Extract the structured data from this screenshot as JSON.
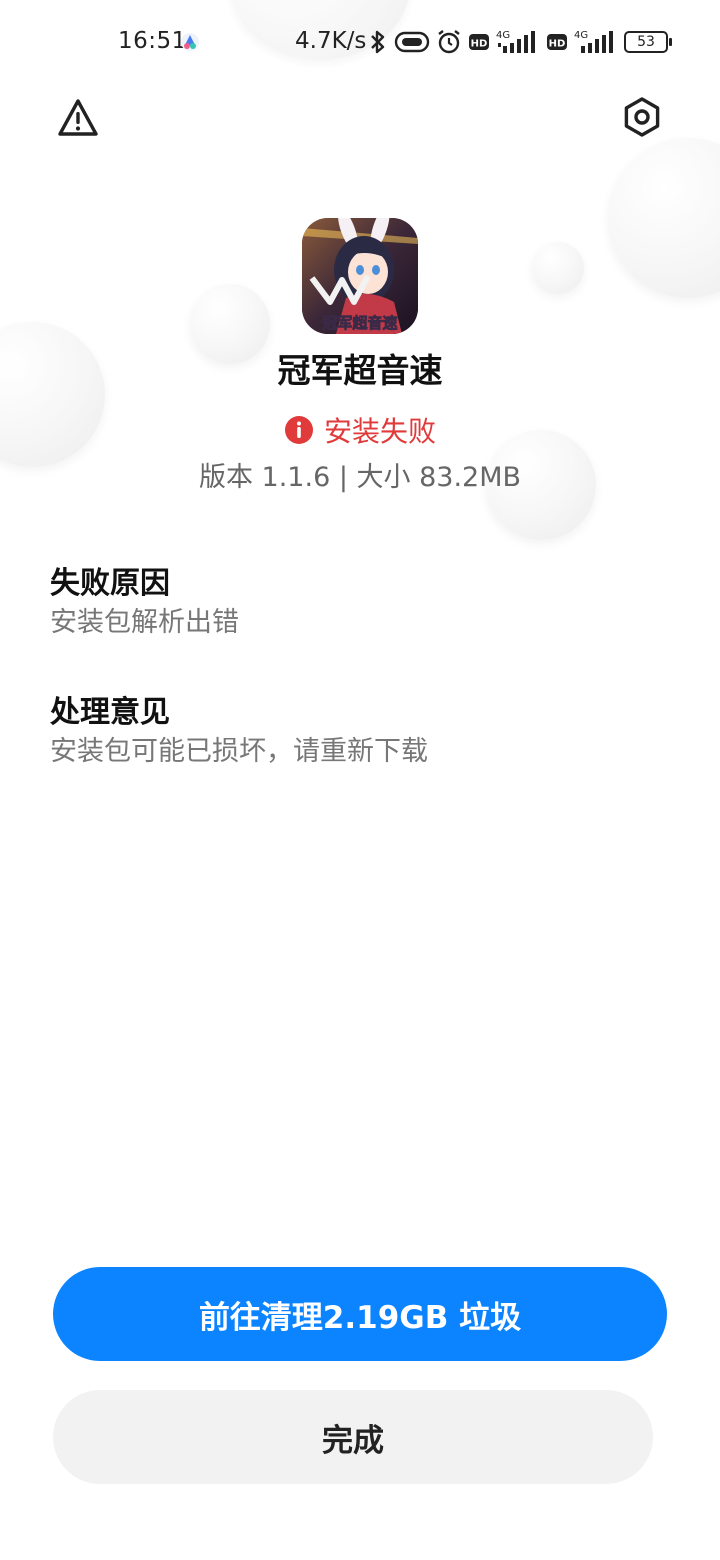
{
  "status_bar": {
    "time": "16:51",
    "net_speed": "4.7K/s",
    "battery": "53",
    "hd1": "HD",
    "hd2": "HD",
    "net1": "4G",
    "net2": "4G"
  },
  "header": {
    "warning_icon": "warning-triangle-icon",
    "settings_icon": "gear-icon"
  },
  "app": {
    "name": "冠军超音速",
    "status": "安装失败",
    "meta": "版本 1.1.6 | 大小 83.2MB",
    "logo_text": "冠军超音速"
  },
  "failure": {
    "title": "失败原因",
    "reason": "安装包解析出错"
  },
  "advice": {
    "title": "处理意见",
    "text": "安装包可能已损坏，请重新下载"
  },
  "buttons": {
    "clean": "前往清理2.19GB 垃圾",
    "done": "完成"
  },
  "colors": {
    "accent": "#0d84ff",
    "error": "#e03a3a",
    "secondary_button": "#f2f2f2"
  }
}
